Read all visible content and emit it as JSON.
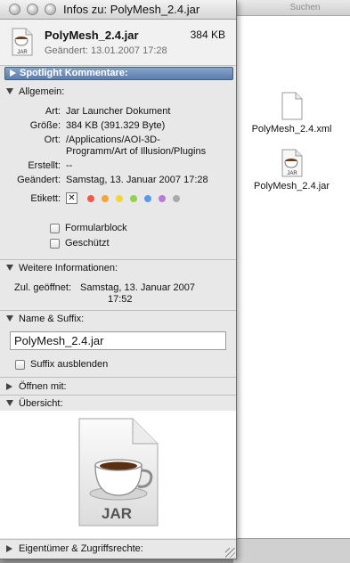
{
  "background_window": {
    "search_label": "Suchen",
    "files": [
      {
        "name": "PolyMesh_2.4.xml",
        "icon": "document-icon"
      },
      {
        "name": "PolyMesh_2.4.jar",
        "icon": "jar-icon"
      }
    ]
  },
  "window": {
    "title": "Infos zu: PolyMesh_2.4.jar"
  },
  "header": {
    "file_name": "PolyMesh_2.4.jar",
    "file_size": "384 KB",
    "modified": "Geändert: 13.01.2007 17:28",
    "icon_label": "JAR"
  },
  "spotlight": {
    "label": "Spotlight Kommentare:"
  },
  "general": {
    "heading": "Allgemein:",
    "rows": [
      {
        "label": "Art:",
        "value": "Jar Launcher Dokument"
      },
      {
        "label": "Größe:",
        "value": "384 KB (391.329 Byte)"
      },
      {
        "label": "Ort:",
        "value": "/Applications/AOI-3D-",
        "value2": "Programm/Art of Illusion/Plugins"
      },
      {
        "label": "Erstellt:",
        "value": "--"
      },
      {
        "label": "Geändert:",
        "value": "Samstag, 13. Januar 2007 17:28"
      }
    ],
    "label_row": {
      "label": "Etikett:",
      "x_glyph": "✕",
      "colors": [
        "#ef5b4b",
        "#f6a43a",
        "#f5d43c",
        "#8fd34a",
        "#5a9bea",
        "#b87ad6",
        "#aaaaaa"
      ]
    },
    "checkboxes": [
      {
        "label": "Formularblock",
        "checked": false
      },
      {
        "label": "Geschützt",
        "checked": false
      }
    ]
  },
  "more_info": {
    "heading": "Weitere Informationen:",
    "last_opened_label": "Zul. geöffnet:",
    "last_opened_value": "Samstag, 13. Januar 2007",
    "last_opened_time": "17:52"
  },
  "name_suffix": {
    "heading": "Name & Suffix:",
    "value": "PolyMesh_2.4.jar",
    "hide_suffix_label": "Suffix ausblenden"
  },
  "open_with": {
    "heading": "Öffnen mit:"
  },
  "preview": {
    "heading": "Übersicht:",
    "icon_label": "JAR"
  },
  "owner": {
    "heading": "Eigentümer & Zugriffsrechte:"
  }
}
